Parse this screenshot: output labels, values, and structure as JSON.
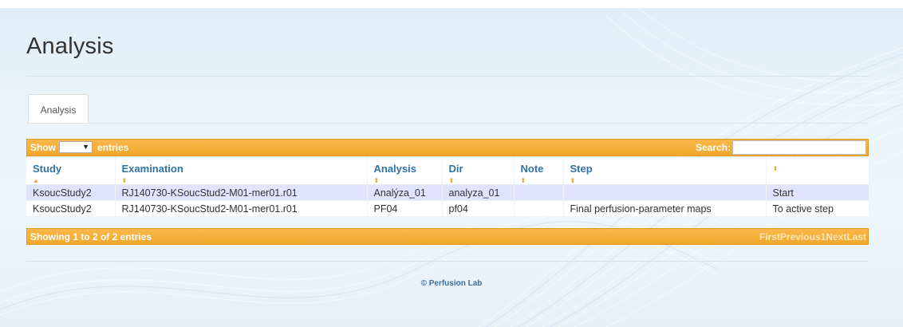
{
  "page": {
    "title": "Analysis"
  },
  "tabs": [
    {
      "label": "Analysis"
    }
  ],
  "table_controls": {
    "show_label": "Show",
    "show_value": "",
    "entries_label": "entries",
    "search_label": "Search:",
    "search_value": ""
  },
  "table": {
    "columns": [
      "Study",
      "Examination",
      "Analysis",
      "Dir",
      "Note",
      "Step",
      ""
    ],
    "rows": [
      {
        "study": "KsoucStudy2",
        "examination": "RJ140730-KSoucStud2-M01-mer01.r01",
        "analysis": "Analýza_01",
        "dir": "analyza_01",
        "note": "",
        "step": "",
        "action": "Start"
      },
      {
        "study": "KsoucStudy2",
        "examination": "RJ140730-KSoucStud2-M01-mer01.r01",
        "analysis": "PF04",
        "dir": "pf04",
        "note": "",
        "step": "Final perfusion-parameter maps",
        "action": "To active step"
      }
    ]
  },
  "table_footer": {
    "info": "Showing 1 to 2 of 2 entries",
    "pager": {
      "first": "First",
      "previous": "Previous",
      "page": "1",
      "next": "Next",
      "last": "Last"
    }
  },
  "footer": {
    "copyright": "© Perfusion Lab"
  },
  "colors": {
    "accent_orange": "#f2a72c",
    "link_blue": "#3474ab",
    "row_highlight": "#e2e4ff"
  },
  "icons": {
    "sort": "sort-updown-icon",
    "sort_active": "sort-up-icon",
    "dropdown": "triangle-down-icon"
  }
}
